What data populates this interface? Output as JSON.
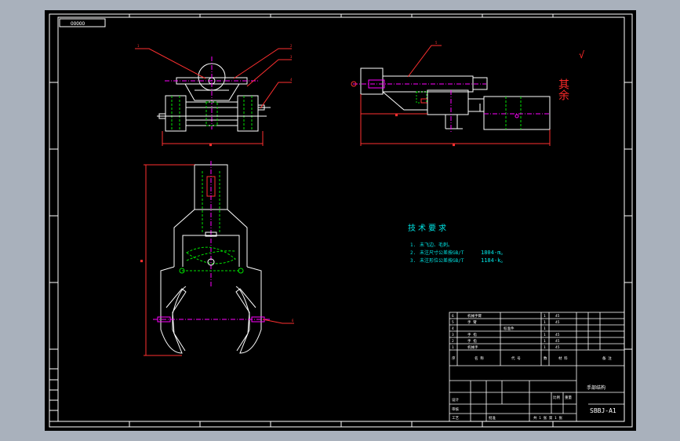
{
  "frame": {
    "background": "#a9b1bc",
    "paper": "#000000",
    "line": "#ffffff"
  },
  "colors": {
    "cyan": "#00e5e5",
    "green": "#00e000",
    "magenta": "#ff00ff",
    "red": "#ff2a2a",
    "white": "#ffffff"
  },
  "drawing_code_box": "ΟΟΟΟΟ",
  "dimension_marks": [
    "■",
    "■",
    "■",
    "■"
  ],
  "leader_marks": [
    "1",
    "2",
    "3",
    "4",
    "5",
    "6"
  ],
  "roughness": {
    "label": "其余",
    "symbol": "√"
  },
  "technical_requirements": {
    "heading": "技术要求",
    "items": [
      {
        "num": "1.",
        "text": "未飞边、毛刺。"
      },
      {
        "num": "2.",
        "text": "未注尺寸公差按GB/T",
        "extra": "1804-m。"
      },
      {
        "num": "3.",
        "text": "未注形位公差按GB/T",
        "extra": "1184-k。"
      }
    ]
  },
  "bom": [
    {
      "no": "6",
      "name": "机械手臂",
      "qty": "1",
      "mat": "45"
    },
    {
      "no": "5",
      "name": "手 臂",
      "code": "",
      "qty": "1",
      "mat": "45"
    },
    {
      "no": "4",
      "name": "",
      "code": "标准件",
      "qty": "1",
      "mat": ""
    },
    {
      "no": "3",
      "name": "手 指",
      "qty": "1",
      "mat": "45"
    },
    {
      "no": "2",
      "name": "手 指",
      "qty": "1",
      "mat": "45"
    },
    {
      "no": "1",
      "name": "机械手",
      "qty": "1",
      "mat": "45"
    }
  ],
  "title_block": {
    "header_cells": [
      "序",
      "名 称",
      "代 号",
      "数",
      "材 料",
      "备 注"
    ],
    "drawing_name": "手部结构",
    "drawing_number": "SBBJ-A1",
    "sheet": "共 1 张  第 1 张",
    "designer_label": "设计",
    "check_label": "审核",
    "process_label": "工艺",
    "approve_label": "批准",
    "scale_label": "比例",
    "weight_label": "重量"
  },
  "side_labels": {
    "left": [
      "A",
      "B",
      "C",
      "D",
      "E",
      "F"
    ],
    "top": [
      "1",
      "2",
      "3",
      "4",
      "5",
      "6",
      "7",
      "8"
    ]
  }
}
